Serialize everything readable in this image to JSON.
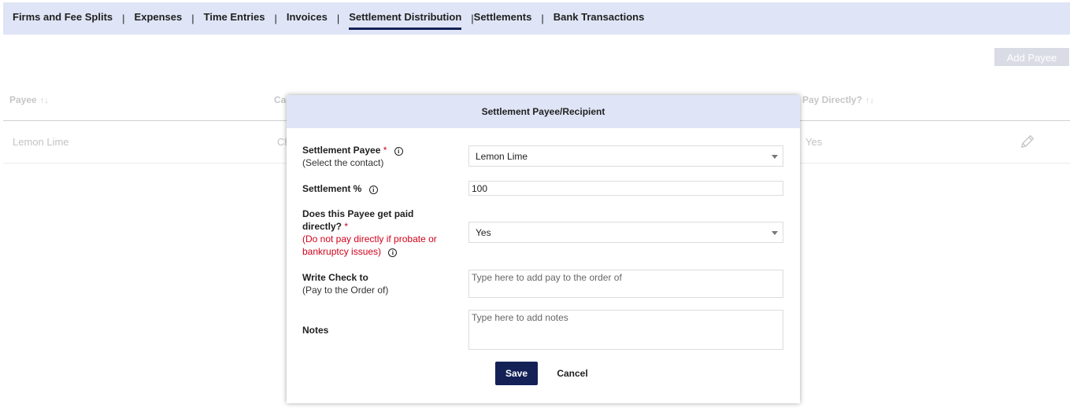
{
  "tabs": [
    {
      "label": "Firms and Fee Splits"
    },
    {
      "label": "Expenses"
    },
    {
      "label": "Time Entries"
    },
    {
      "label": "Invoices"
    },
    {
      "label": "Settlement Distribution",
      "active": true
    },
    {
      "label": "Settlements"
    },
    {
      "label": "Bank Transactions"
    }
  ],
  "tab_separator": "|",
  "page": {
    "add_payee_label": "Add Payee",
    "columns": {
      "payee": "Payee",
      "ca": "Ca",
      "pay_directly": "Pay Directly?"
    },
    "sort_glyph": "↑↓",
    "row": {
      "payee": "Lemon Lime",
      "ca": "Ch",
      "pay_directly": "Yes"
    }
  },
  "modal": {
    "title": "Settlement Payee/Recipient",
    "settlement_payee": {
      "label": "Settlement Payee",
      "required_mark": "*",
      "sub": "(Select the contact)",
      "value": "Lemon Lime"
    },
    "settlement_percent": {
      "label": "Settlement %",
      "value": "100"
    },
    "paid_directly": {
      "label_line1": "Does this Payee get paid",
      "label_line2": "directly?",
      "required_mark": "*",
      "warning_line1": "(Do not pay directly if probate or",
      "warning_line2": "bankruptcy issues)",
      "value": "Yes"
    },
    "write_check": {
      "label": "Write Check to",
      "sub": "(Pay to the Order of)",
      "placeholder": "Type here to add pay to the order of"
    },
    "notes": {
      "label": "Notes",
      "placeholder": "Type here to add notes"
    },
    "save_label": "Save",
    "cancel_label": "Cancel",
    "info_glyph": "i"
  },
  "colors": {
    "accent": "#142157",
    "header_bg": "#dfe5f6",
    "required": "#d0021b"
  }
}
